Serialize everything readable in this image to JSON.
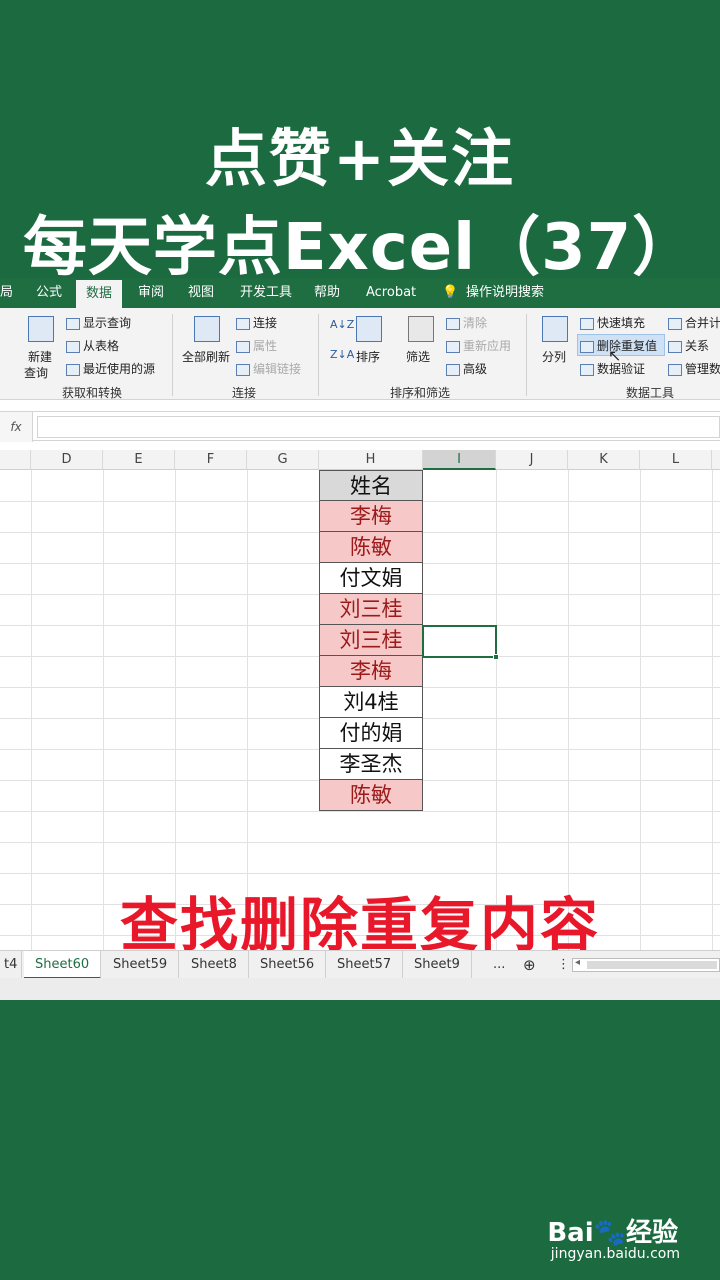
{
  "headline": {
    "line1": "点赞+关注",
    "line2": "每天学点Excel（37）"
  },
  "ribbon_tabs": [
    "局",
    "公式",
    "数据",
    "审阅",
    "视图",
    "开发工具",
    "帮助",
    "Acrobat",
    "操作说明搜索"
  ],
  "ribbon": {
    "get_transform": {
      "new_query": "新建",
      "new_query2": "查询",
      "show_query": "显示查询",
      "from_table": "从表格",
      "recent_sources": "最近使用的源",
      "group": "获取和转换"
    },
    "connections": {
      "refresh_all": "全部刷新",
      "connections": "连接",
      "properties": "属性",
      "edit_links": "编辑链接",
      "group": "连接"
    },
    "sort_filter": {
      "az": "A↓Z",
      "za": "Z↓A",
      "sort": "排序",
      "filter": "筛选",
      "clear": "清除",
      "reapply": "重新应用",
      "advanced": "高级",
      "group": "排序和筛选"
    },
    "data_tools": {
      "split": "分列",
      "flash_fill": "快速填充",
      "remove_dup": "删除重复值",
      "validation": "数据验证",
      "merge": "合并计",
      "relations": "关系",
      "manage": "管理数",
      "group": "数据工具"
    }
  },
  "formula": {
    "fx": "fx"
  },
  "columns": [
    "D",
    "E",
    "F",
    "G",
    "H",
    "I",
    "J",
    "K",
    "L"
  ],
  "table": {
    "header": "姓名",
    "rows": [
      {
        "name": "李梅",
        "dup": true
      },
      {
        "name": "陈敏",
        "dup": true
      },
      {
        "name": "付文娟",
        "dup": false
      },
      {
        "name": "刘三桂",
        "dup": true
      },
      {
        "name": "刘三桂",
        "dup": true
      },
      {
        "name": "李梅",
        "dup": true
      },
      {
        "name": "刘4桂",
        "dup": false
      },
      {
        "name": "付的娟",
        "dup": false
      },
      {
        "name": "李圣杰",
        "dup": false
      },
      {
        "name": "陈敏",
        "dup": true
      }
    ]
  },
  "banner": "查找删除重复内容",
  "sheets": [
    "t4",
    "Sheet60",
    "Sheet59",
    "Sheet8",
    "Sheet56",
    "Sheet57",
    "Sheet9",
    "..."
  ],
  "watermark": {
    "brand": "Bai🐾经验",
    "url": "jingyan.baidu.com"
  },
  "colors": {
    "excel_green": "#1e6e42",
    "dup_fill": "#f6c8c8",
    "dup_text": "#9c1a1a",
    "banner_red": "#e8182a"
  }
}
